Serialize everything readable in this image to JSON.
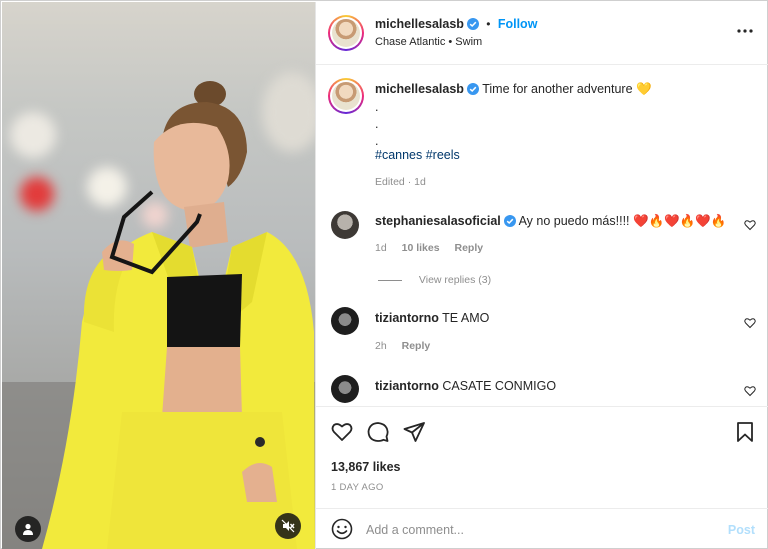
{
  "post": {
    "author": "michellesalasb",
    "follow_label": "Follow",
    "dot": "•",
    "audio": "Chase Atlantic • Swim",
    "more_icon": "more-horizontal-icon"
  },
  "caption": {
    "username": "michellesalasb",
    "text": "Time for another adventure 💛",
    "dots": [
      ".",
      ".",
      "."
    ],
    "hashtags": "#cannes #reels",
    "edited": "Edited · 1d"
  },
  "comments": [
    {
      "username": "stephaniesalasoficial",
      "text": "Ay no puedo más!!!! ❤️🔥❤️🔥❤️🔥",
      "time": "1d",
      "likes": "10 likes",
      "reply": "Reply",
      "view_replies": "View replies (3)"
    },
    {
      "username": "tiziantorno",
      "text": "TE AMO",
      "time": "2h",
      "reply": "Reply"
    },
    {
      "username": "tiziantorno",
      "text": "CASATE CONMIGO"
    }
  ],
  "actions": {
    "likes": "13,867 likes",
    "date": "1 DAY AGO"
  },
  "composer": {
    "placeholder": "Add a comment...",
    "post_label": "Post"
  },
  "colors": {
    "accent": "#0095f6",
    "verified": "#3897f0",
    "post_disabled": "#b2dffc",
    "jacket": "#f2ea3c"
  }
}
